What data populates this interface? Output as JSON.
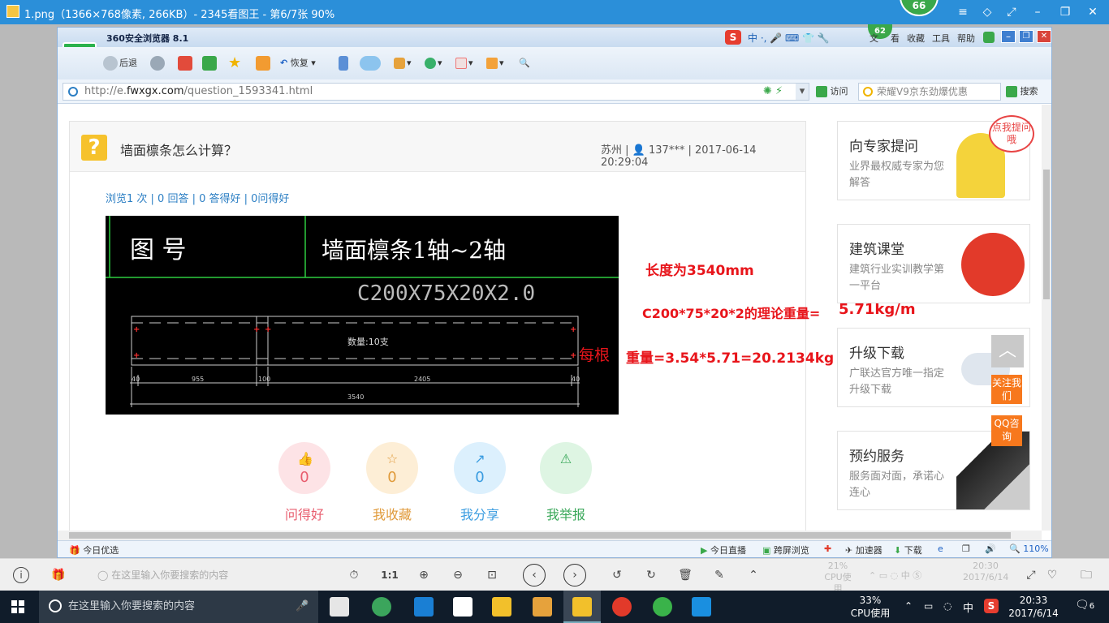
{
  "viewer": {
    "title": "1.png（1366×768像素, 266KB）- 2345看图王 - 第6/7张 90%",
    "badge": "66"
  },
  "browser": {
    "name": "360安全浏览器 8.1",
    "badge": "62",
    "menu": [
      "文",
      "看",
      "收藏",
      "工具",
      "帮助"
    ],
    "toolbar": {
      "back": "后退",
      "restore": "恢复"
    },
    "url_prefix": "http://e.",
    "url_domain": "fwxgx.com",
    "url_path": "/question_1593341.html",
    "visit": "访问",
    "search_placeholder": "荣耀V9京东劲爆优惠",
    "search_button": "搜索",
    "status": {
      "left": "今日优选",
      "live": "今日直播",
      "cross": "跨屏浏览",
      "accel": "加速器",
      "download": "下载",
      "zoom": "110%"
    }
  },
  "question": {
    "title": "墙面檩条怎么计算？",
    "location": "苏州",
    "user": "137***",
    "datetime": "2017-06-14 20:29:04",
    "stats": "浏览1 次 | 0 回答 | 0 答得好 | 0问得好"
  },
  "drawing": {
    "cell_label": "图  号",
    "cell_title": "墙面檩条1轴~2轴",
    "section": "C200X75X20X2.0",
    "qty": "数量:10支",
    "dims": [
      "40",
      "955",
      "100",
      "2405",
      "40",
      "3540"
    ]
  },
  "notes": {
    "length": "长度为3540mm",
    "weight_per_m": "C200*75*20*2的理论重量=",
    "weight_val": "5.71kg/m",
    "each": "每根",
    "total": "重量=3.54*5.71=20.2134kg"
  },
  "actions": [
    {
      "label": "问得好",
      "count": "0",
      "color": "#e85d6e",
      "bg": "#fde3e6"
    },
    {
      "label": "我收藏",
      "count": "0",
      "color": "#e09a3a",
      "bg": "#fdeed6"
    },
    {
      "label": "我分享",
      "count": "0",
      "color": "#3a9ce0",
      "bg": "#dcf0fd"
    },
    {
      "label": "我举报",
      "count": "",
      "color": "#3aa85a",
      "bg": "#def5e3"
    }
  ],
  "sidebar": [
    {
      "title": "向专家提问",
      "desc": "业界最权威专家为您解答",
      "bubble": "点我提问哦"
    },
    {
      "title": "建筑课堂",
      "desc": "建筑行业实训教学第一平台"
    },
    {
      "title": "升级下载",
      "desc": "广联达官方唯一指定升级下载"
    },
    {
      "title": "预约服务",
      "desc": "服务面对面，承诺心连心"
    }
  ],
  "float": {
    "follow": "关注我们",
    "qq": "QQ咨询"
  },
  "viewer_bar": {
    "search_placeholder": "在这里输入你要搜索的内容",
    "ratio": "1:1",
    "cpu": "21%",
    "cpu_label": "CPU使用",
    "time": "20:30",
    "date": "2017/6/14"
  },
  "taskbar": {
    "search_placeholder": "在这里输入你要搜索的内容",
    "cpu": "33%",
    "cpu_label": "CPU使用",
    "ime": "中",
    "time": "20:33",
    "date": "2017/6/14",
    "notif": "6"
  }
}
